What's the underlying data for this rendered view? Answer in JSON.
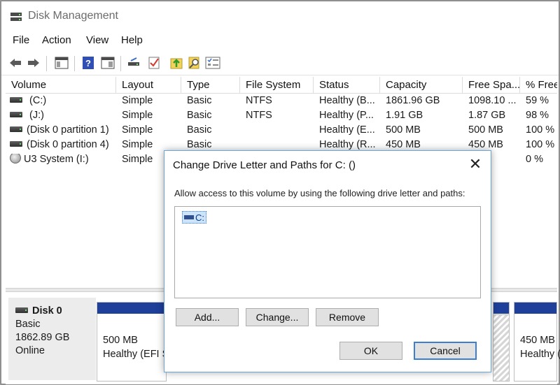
{
  "window": {
    "title": "Disk Management"
  },
  "menu": [
    "File",
    "Action",
    "View",
    "Help"
  ],
  "toolbar": {
    "icons": [
      "back-arrow-icon",
      "forward-arrow-icon",
      "show-hide-console-tree-icon",
      "help-icon",
      "properties-icon",
      "connect-drive-icon",
      "check-icon",
      "rescan-icon",
      "search-icon",
      "list-view-icon"
    ]
  },
  "volume_list": {
    "columns": [
      "Volume",
      "Layout",
      "Type",
      "File System",
      "Status",
      "Capacity",
      "Free Spa...",
      "% Free"
    ],
    "rows": [
      {
        "icon": "drive",
        "volume": " (C:)",
        "layout": "Simple",
        "type": "Basic",
        "fs": "NTFS",
        "status": "Healthy (B...",
        "capacity": "1861.96 GB",
        "free": "1098.10 ...",
        "pct": "59 %"
      },
      {
        "icon": "drive",
        "volume": " (J:)",
        "layout": "Simple",
        "type": "Basic",
        "fs": "NTFS",
        "status": "Healthy (P...",
        "capacity": "1.91 GB",
        "free": "1.87 GB",
        "pct": "98 %"
      },
      {
        "icon": "drive",
        "volume": "(Disk 0 partition 1)",
        "layout": "Simple",
        "type": "Basic",
        "fs": "",
        "status": "Healthy (E...",
        "capacity": "500 MB",
        "free": "500 MB",
        "pct": "100 %"
      },
      {
        "icon": "drive",
        "volume": "(Disk 0 partition 4)",
        "layout": "Simple",
        "type": "Basic",
        "fs": "",
        "status": "Healthy (R...",
        "capacity": "450 MB",
        "free": "450 MB",
        "pct": "100 %"
      },
      {
        "icon": "u3",
        "volume": "U3 System (I:)",
        "layout": "Simple",
        "type": "",
        "fs": "",
        "status": "",
        "capacity": "",
        "free": "",
        "pct": "0 %"
      }
    ]
  },
  "disk_map": {
    "disk": {
      "name": "Disk 0",
      "type": "Basic",
      "size": "1862.89 GB",
      "state": "Online"
    },
    "partitions": [
      {
        "size": "500 MB",
        "status": "Healthy (EFI S"
      },
      {
        "size": "450 MB",
        "status": "Healthy ("
      }
    ]
  },
  "dialog": {
    "title": "Change Drive Letter and Paths for C: ()",
    "description": "Allow access to this volume by using the following drive letter and paths:",
    "list_items": [
      "C:"
    ],
    "buttons": {
      "add": "Add...",
      "change": "Change...",
      "remove": "Remove",
      "ok": "OK",
      "cancel": "Cancel"
    },
    "close_glyph": "✕"
  }
}
